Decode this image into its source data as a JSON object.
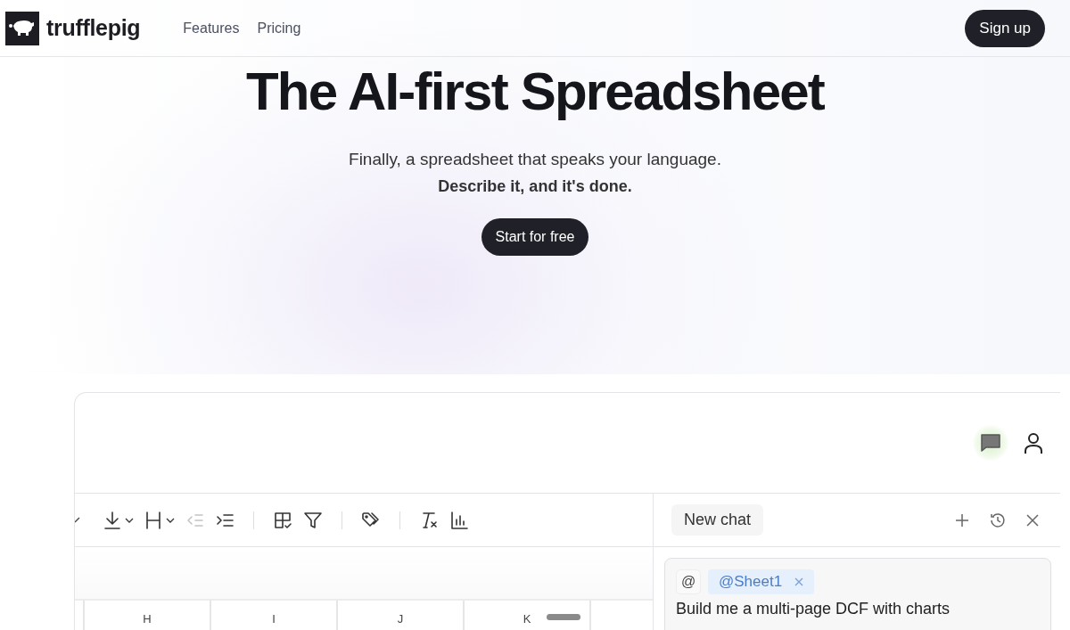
{
  "header": {
    "brand": "trufflepig",
    "nav": [
      {
        "label": "Features"
      },
      {
        "label": "Pricing"
      }
    ],
    "signup": "Sign up"
  },
  "hero": {
    "title": "The AI-first Spreadsheet",
    "subtitle": "Finally, a spreadsheet that speaks your language.",
    "tagline": "Describe it, and it's done.",
    "cta": "Start for free"
  },
  "app": {
    "chat_toggle": {
      "on": true
    },
    "toolbar": [
      {
        "menu": true,
        "disabled": false
      },
      {
        "menu": true,
        "disabled": false
      },
      {
        "disabled": true
      },
      {
        "disabled": false
      },
      {
        "disabled": false,
        "separator": true
      },
      {
        "disabled": false
      },
      {
        "disabled": false,
        "separator": true
      },
      {
        "disabled": false,
        "separator": true
      },
      {
        "disabled": false
      }
    ],
    "columns": [
      "H",
      "I",
      "J",
      "K"
    ],
    "chat": {
      "tab": "New chat",
      "mention_button": "@",
      "context": [
        {
          "label": "@Sheet1"
        }
      ],
      "message": "Build me a multi-page DCF with charts"
    }
  }
}
